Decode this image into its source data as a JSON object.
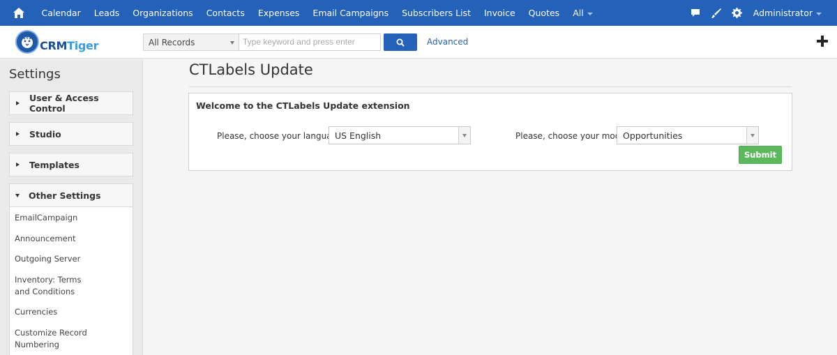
{
  "topnav": {
    "items": [
      "Calendar",
      "Leads",
      "Organizations",
      "Contacts",
      "Expenses",
      "Email Campaigns",
      "Subscribers List",
      "Invoice",
      "Quotes",
      "All"
    ],
    "user": "Administrator"
  },
  "searchbar": {
    "logo_crm": "CRM",
    "logo_tiger": "Tiger",
    "records_select": "All Records",
    "keyword_placeholder": "Type keyword and press enter",
    "advanced_link": "Advanced"
  },
  "sidebar": {
    "title": "Settings",
    "menus": [
      "User & Access Control",
      "Studio",
      "Templates",
      "Other Settings"
    ],
    "other_settings_items": [
      "EmailCampaign",
      "Announcement",
      "Outgoing Server",
      "Inventory: Terms and Conditions",
      "Currencies",
      "Customize Record Numbering"
    ]
  },
  "main": {
    "title": "CTLabels Update",
    "welcome": "Welcome to the CTLabels Update extension",
    "language_label": "Please, choose your language:",
    "language_value": "US English",
    "module_label": "Please, choose your modul:",
    "module_value": "Opportunities",
    "submit_label": "Submit"
  },
  "colors": {
    "nav_blue": "#2461b8",
    "submit_green": "#5cb85c"
  }
}
